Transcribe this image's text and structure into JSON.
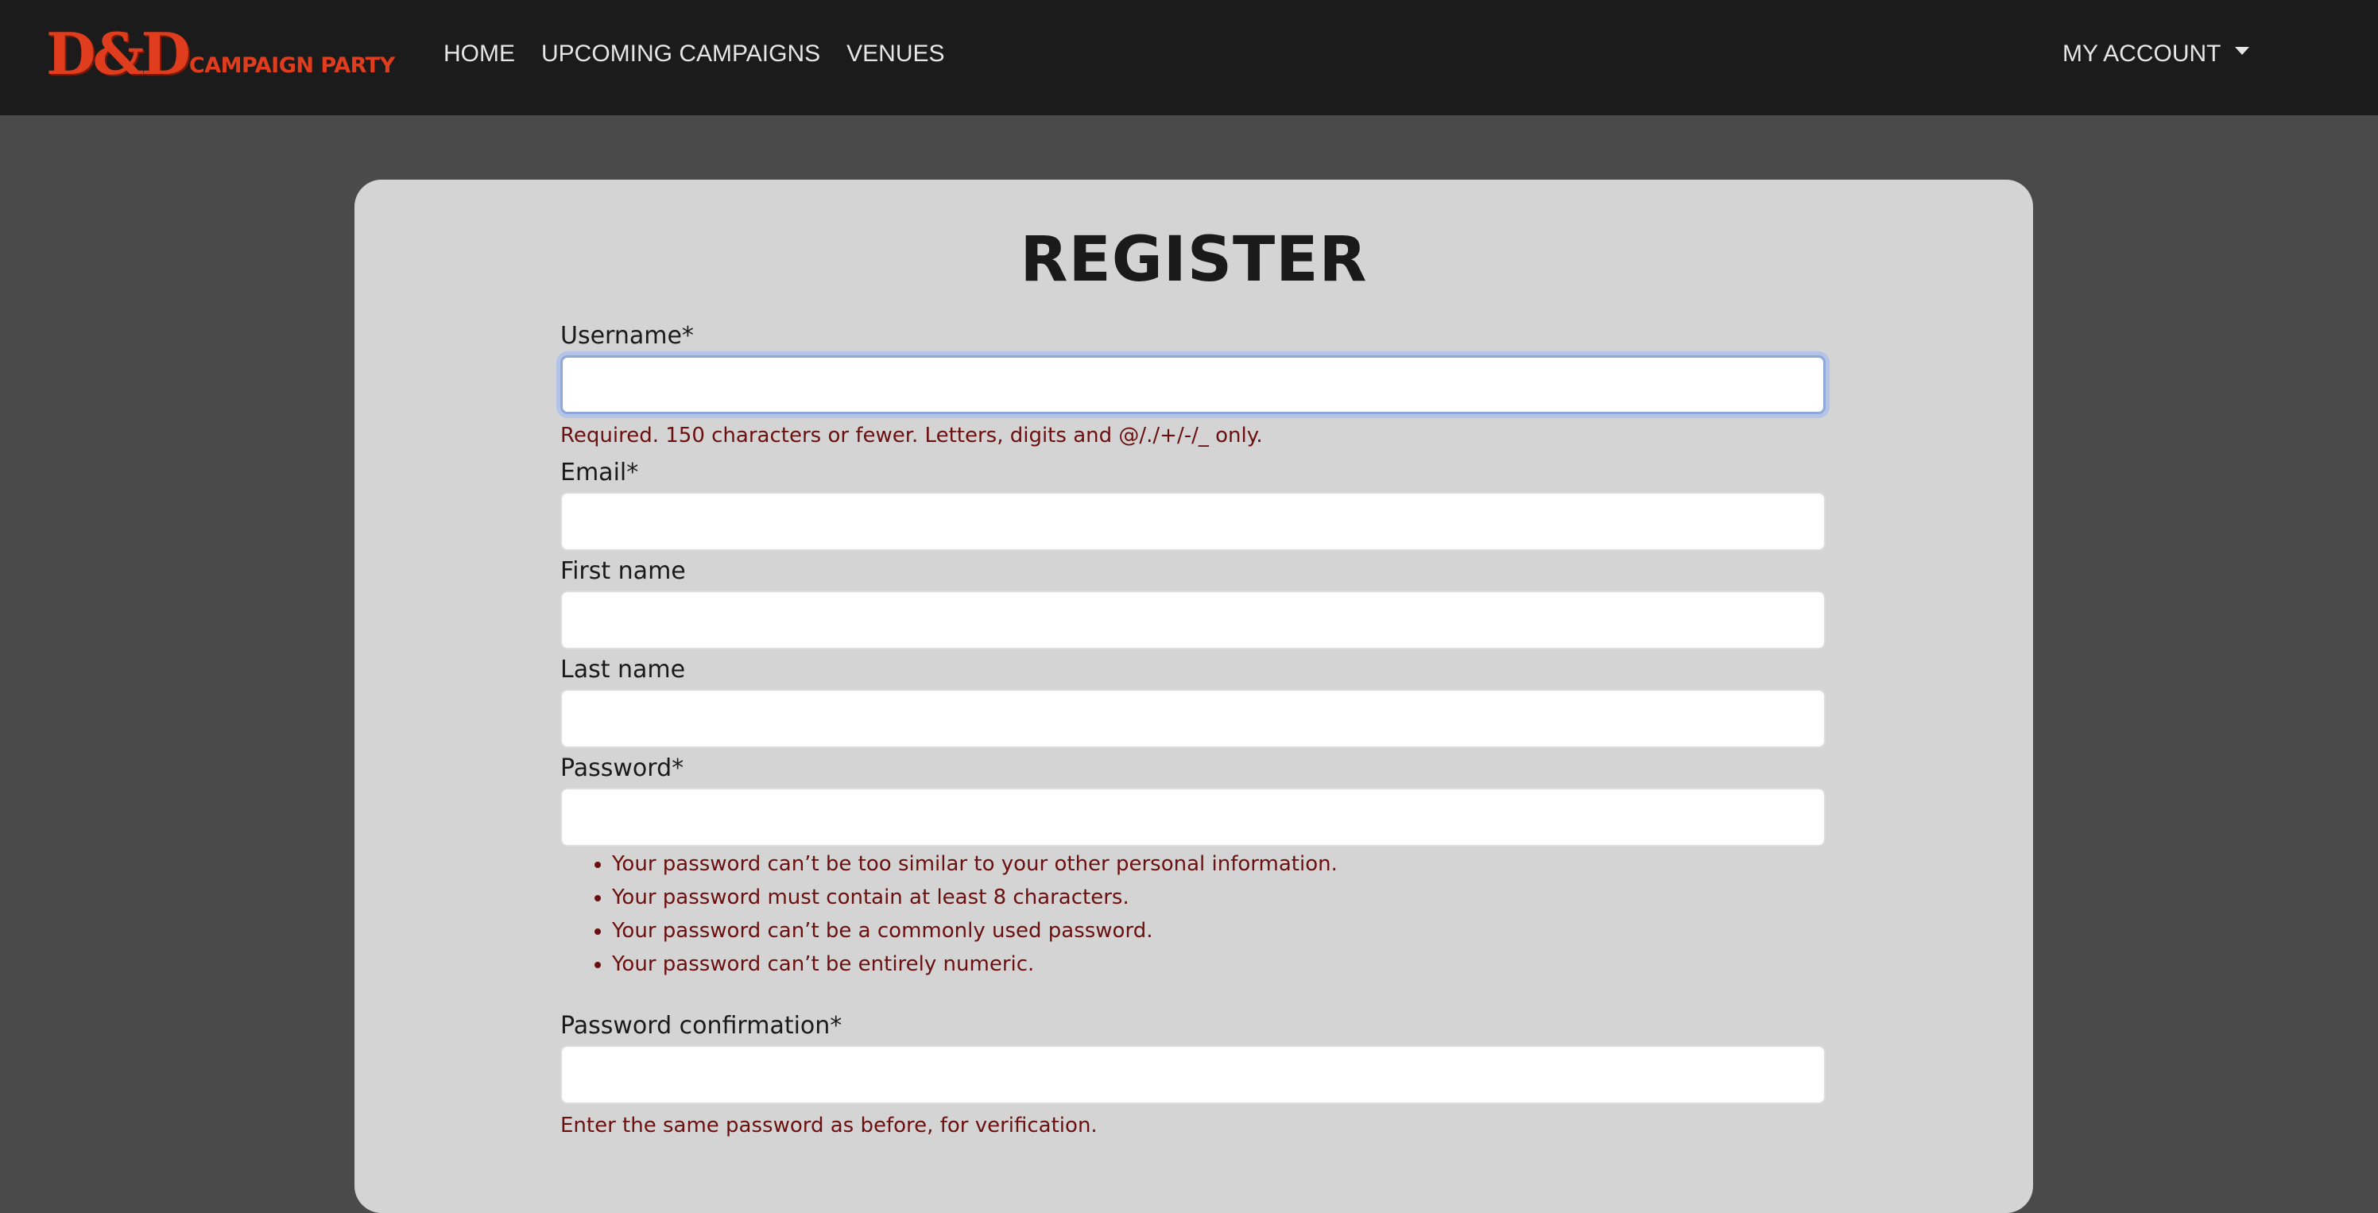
{
  "nav": {
    "logo_mark": "D&D",
    "logo_text": "CAMPAIGN PARTY",
    "links": [
      "HOME",
      "UPCOMING CAMPAIGNS",
      "VENUES"
    ],
    "account_label": "MY ACCOUNT"
  },
  "form": {
    "title": "REGISTER",
    "username_label": "Username*",
    "username_help": "Required. 150 characters or fewer. Letters, digits and @/./+/-/_ only.",
    "email_label": "Email*",
    "first_name_label": "First name",
    "last_name_label": "Last name",
    "password_label": "Password*",
    "password_help": [
      "Your password can’t be too similar to your other personal information.",
      "Your password must contain at least 8 characters.",
      "Your password can’t be a commonly used password.",
      "Your password can’t be entirely numeric."
    ],
    "password_confirm_label": "Password confirmation*",
    "password_confirm_help": "Enter the same password as before, for verification."
  },
  "colors": {
    "navbar_bg": "#1b1b1b",
    "page_bg": "#4a4a4a",
    "card_bg": "#d4d4d4",
    "brand": "#e03d1e",
    "help_text": "#6b0f0f",
    "focus_ring": "#b3c4e6"
  },
  "icons": {
    "account_dropdown": "caret-down-icon"
  }
}
